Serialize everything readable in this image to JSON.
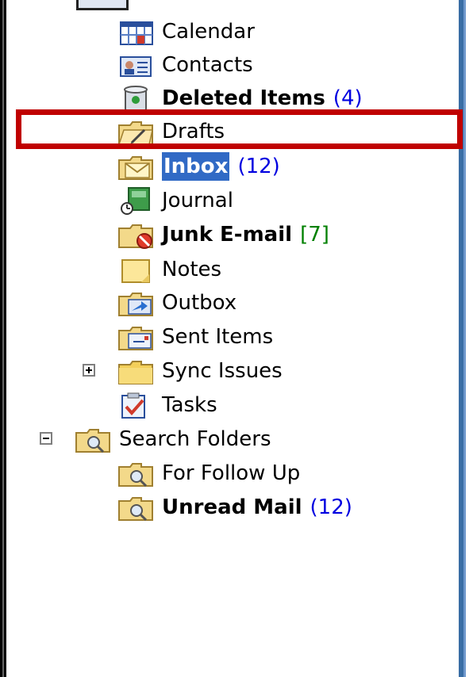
{
  "folders": {
    "calendar": {
      "label": "Calendar",
      "icon": "calendar-icon"
    },
    "contacts": {
      "label": "Contacts",
      "icon": "contacts-icon"
    },
    "deleted_items": {
      "label": "Deleted Items",
      "count": "(4)",
      "icon": "deleted-items-icon"
    },
    "drafts": {
      "label": "Drafts",
      "icon": "drafts-icon"
    },
    "inbox": {
      "label": "Inbox",
      "count": "(12)",
      "icon": "inbox-icon"
    },
    "journal": {
      "label": "Journal",
      "icon": "journal-icon"
    },
    "junk": {
      "label": "Junk E-mail",
      "count": "[7]",
      "icon": "junk-icon"
    },
    "notes": {
      "label": "Notes",
      "icon": "notes-icon"
    },
    "outbox": {
      "label": "Outbox",
      "icon": "outbox-icon"
    },
    "sent_items": {
      "label": "Sent Items",
      "icon": "sent-items-icon"
    },
    "sync_issues": {
      "label": "Sync Issues",
      "icon": "folder-icon"
    },
    "tasks": {
      "label": "Tasks",
      "icon": "tasks-icon"
    },
    "search_folders": {
      "label": "Search Folders",
      "icon": "search-folder-icon"
    },
    "for_follow_up": {
      "label": "For Follow Up",
      "icon": "search-folder-icon"
    },
    "unread_mail": {
      "label": "Unread Mail",
      "count": "(12)",
      "icon": "search-folder-icon"
    }
  },
  "colors": {
    "selection": "#316ac5",
    "unread_count": "#0000e0",
    "junk_count": "#008000",
    "highlight_border": "#c00000"
  }
}
